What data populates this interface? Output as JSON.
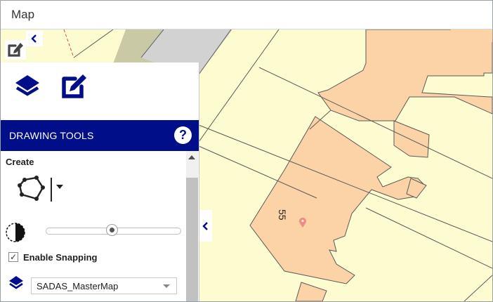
{
  "window": {
    "title": "Map"
  },
  "map": {
    "colors": {
      "background": "#fdfbd0",
      "building": "#fcd3a7",
      "road": "#c9c9a6",
      "grey_area": "#d2d2d2",
      "line": "#5a5a5a",
      "pin": "#f08a8a"
    },
    "labels": {
      "house_number": "55"
    }
  },
  "panel": {
    "tabs": [
      {
        "icon": "layers-icon"
      },
      {
        "icon": "draw-edit-icon"
      }
    ],
    "header": {
      "title": "DRAWING TOOLS",
      "help": "?"
    },
    "create_label": "Create",
    "tool": {
      "icon": "polygon-draw-icon"
    },
    "opacity_slider": {
      "value_percent": 50
    },
    "snapping": {
      "label": "Enable Snapping",
      "checked": true,
      "mark": "✓"
    },
    "layer_select": {
      "value": "SADAS_MasterMap"
    }
  },
  "colors": {
    "accent": "#000e8a",
    "icon_blue": "#000e8a"
  }
}
